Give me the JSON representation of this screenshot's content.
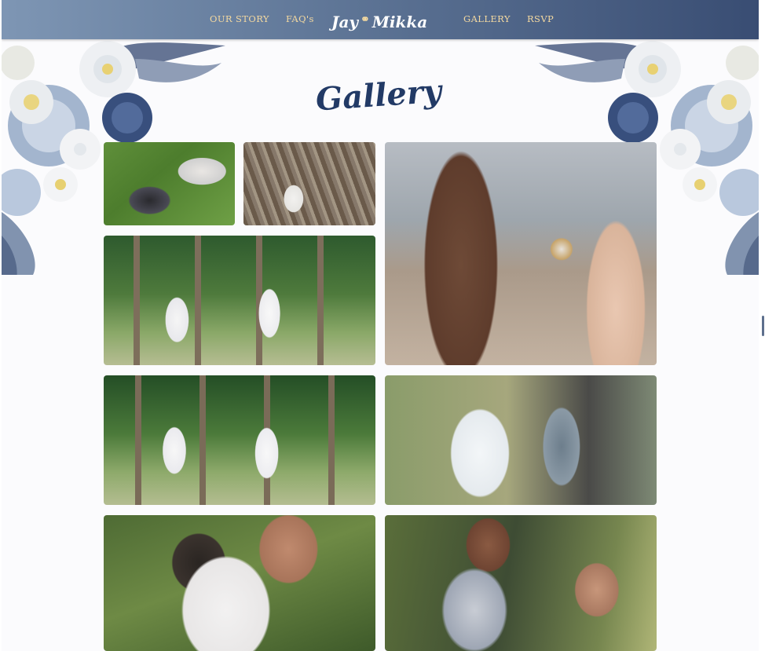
{
  "nav": {
    "links_left": [
      "OUR STORY",
      "FAQ's"
    ],
    "brand": {
      "name_left": "Jay",
      "name_right": "Mikka"
    },
    "links_right": [
      "GALLERY",
      "RSVP"
    ]
  },
  "section": {
    "title": "Gallery"
  },
  "gallery": {
    "photos": [
      {
        "subject": "couple lying on grass"
      },
      {
        "subject": "couple sitting in tree"
      },
      {
        "subject": "couple running among palm trees"
      },
      {
        "subject": "holding hands close-up"
      },
      {
        "subject": "couple playing among palm trees"
      },
      {
        "subject": "couple dancing in garden"
      },
      {
        "subject": "couple laughing close-up"
      },
      {
        "subject": "couple smiling near window"
      }
    ]
  },
  "colors": {
    "nav_start": "#7e96b4",
    "nav_end": "#394d73",
    "nav_link": "#f4d9a0",
    "title": "#223a66",
    "background": "#fbfbfd"
  }
}
